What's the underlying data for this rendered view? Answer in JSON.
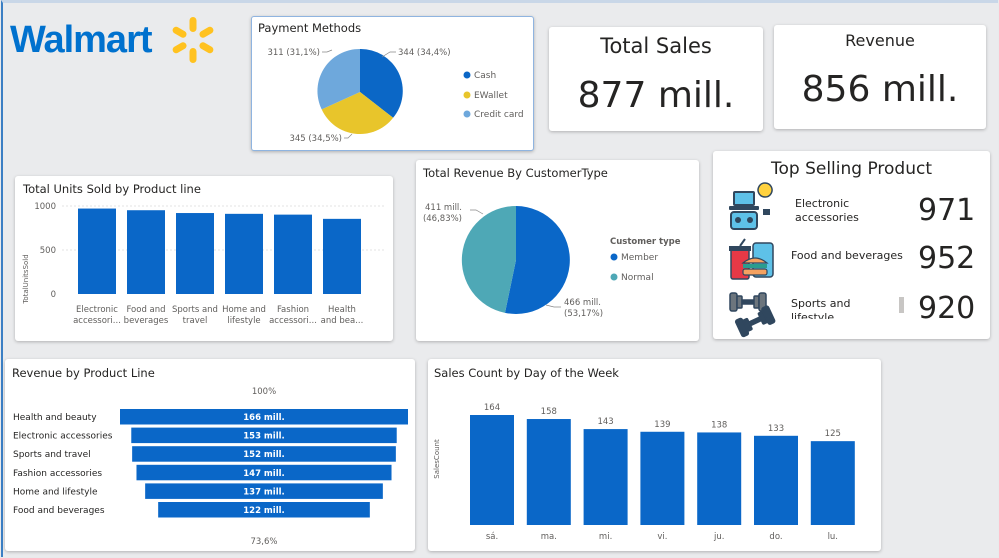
{
  "brand": {
    "name": "Walmart",
    "color": "#0071ce",
    "spark_color": "#ffc220"
  },
  "colors": {
    "bar": "#0a67c8",
    "cash": "#0b67c6",
    "ewallet": "#e8c52b",
    "credit": "#6ea8dc",
    "member": "#0a67c8",
    "normal": "#4ea8b6"
  },
  "payment": {
    "title": "Payment Methods",
    "slices": [
      {
        "name": "Cash",
        "value": 344,
        "label": "344 (34,4%)"
      },
      {
        "name": "EWallet",
        "value": 345,
        "label": "345 (34,5%)"
      },
      {
        "name": "Credit card",
        "value": 311,
        "label": "311 (31,1%)"
      }
    ]
  },
  "kpi_sales": {
    "title": "Total Sales",
    "value": "877 mill."
  },
  "kpi_revenue": {
    "title": "Revenue",
    "value": "856 mill."
  },
  "units": {
    "title": "Total Units Sold by Product line",
    "ylabel": "TotalUnitsSold",
    "ticks": [
      "1000",
      "500",
      "0"
    ],
    "categories": [
      [
        "Electronic",
        "accessori..."
      ],
      [
        "Food and",
        "beverages"
      ],
      [
        "Sports and",
        "travel"
      ],
      [
        "Home and",
        "lifestyle"
      ],
      [
        "Fashion",
        "accessori..."
      ],
      [
        "Health",
        "and bea..."
      ]
    ],
    "values": [
      971,
      952,
      920,
      911,
      902,
      854
    ],
    "ylim": [
      0,
      1000
    ]
  },
  "customer": {
    "title": "Total Revenue By CustomerType",
    "legend_title": "Customer type",
    "slices": [
      {
        "name": "Member",
        "value": 466,
        "label_l1": "466 mill.",
        "label_l2": "(53,17%)"
      },
      {
        "name": "Normal",
        "value": 411,
        "label_l1": "411 mill.",
        "label_l2": "(46,83%)"
      }
    ]
  },
  "top": {
    "title": "Top Selling Product",
    "items": [
      {
        "name": "Electronic accessories",
        "value": "971",
        "icon": "electronics-icon"
      },
      {
        "name": "Food and beverages",
        "value": "952",
        "icon": "food-icon"
      },
      {
        "name": "Sports and lifestyle",
        "value": "920",
        "icon": "dumbbell-icon"
      }
    ]
  },
  "funnel": {
    "title": "Revenue by Product Line",
    "top_pct": "100%",
    "bottom_pct": "73,6%",
    "rows": [
      {
        "name": "Health and beauty",
        "value": 166,
        "label": "166 mill."
      },
      {
        "name": "Electronic accessories",
        "value": 153,
        "label": "153 mill."
      },
      {
        "name": "Sports and travel",
        "value": 152,
        "label": "152 mill."
      },
      {
        "name": "Fashion accessories",
        "value": 147,
        "label": "147 mill."
      },
      {
        "name": "Home and lifestyle",
        "value": 137,
        "label": "137 mill."
      },
      {
        "name": "Food and beverages",
        "value": 122,
        "label": "122 mill."
      }
    ]
  },
  "weekday": {
    "title": "Sales Count by Day of the Week",
    "ylabel": "SalesCount",
    "categories": [
      "sá.",
      "ma.",
      "mi.",
      "vi.",
      "ju.",
      "do.",
      "lu."
    ],
    "values": [
      164,
      158,
      143,
      139,
      138,
      133,
      125
    ]
  },
  "chart_data": [
    {
      "type": "pie",
      "title": "Payment Methods",
      "categories": [
        "Cash",
        "EWallet",
        "Credit card"
      ],
      "values": [
        344,
        345,
        311
      ]
    },
    {
      "type": "bar",
      "title": "Total Units Sold by Product line",
      "ylabel": "TotalUnitsSold",
      "categories": [
        "Electronic accessori...",
        "Food and beverages",
        "Sports and travel",
        "Home and lifestyle",
        "Fashion accessori...",
        "Health and bea..."
      ],
      "values": [
        971,
        952,
        920,
        911,
        902,
        854
      ],
      "ylim": [
        0,
        1000
      ]
    },
    {
      "type": "pie",
      "title": "Total Revenue By CustomerType",
      "categories": [
        "Member",
        "Normal"
      ],
      "values": [
        466,
        411
      ]
    },
    {
      "type": "bar",
      "title": "Revenue by Product Line",
      "categories": [
        "Health and beauty",
        "Electronic accessories",
        "Sports and travel",
        "Fashion accessories",
        "Home and lifestyle",
        "Food and beverages"
      ],
      "values": [
        166,
        153,
        152,
        147,
        137,
        122
      ]
    },
    {
      "type": "bar",
      "title": "Sales Count by Day of the Week",
      "ylabel": "SalesCount",
      "categories": [
        "sá.",
        "ma.",
        "mi.",
        "vi.",
        "ju.",
        "do.",
        "lu."
      ],
      "values": [
        164,
        158,
        143,
        139,
        138,
        133,
        125
      ]
    }
  ]
}
